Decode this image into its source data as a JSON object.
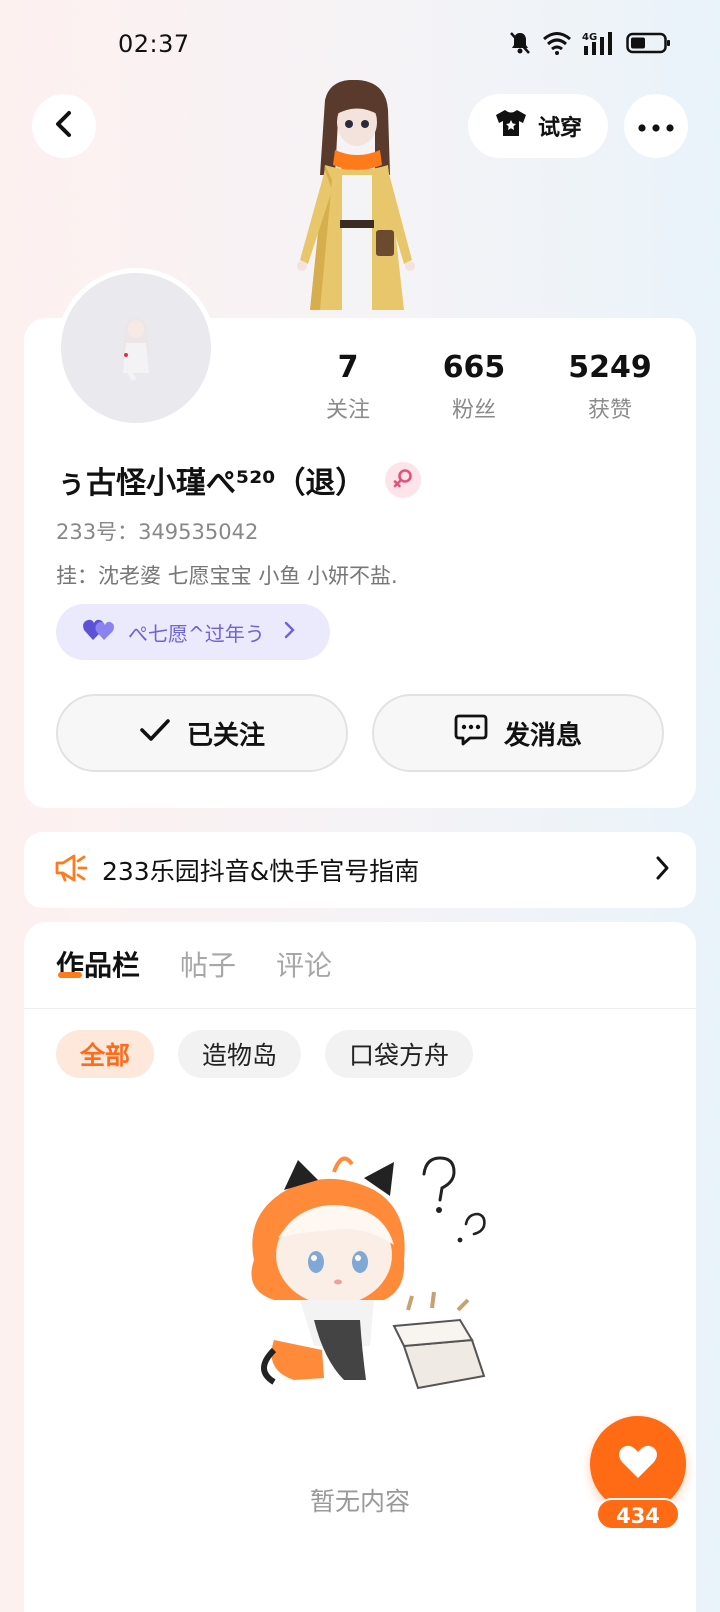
{
  "status_bar": {
    "time": "02:37",
    "network": "4G"
  },
  "header": {
    "try_on_label": "试穿",
    "icons": [
      "back-icon",
      "tshirt-icon",
      "more-icon"
    ]
  },
  "profile": {
    "stats": [
      {
        "value": "7",
        "label": "关注"
      },
      {
        "value": "665",
        "label": "粉丝"
      },
      {
        "value": "5249",
        "label": "获赞"
      }
    ],
    "username": "ぅ古怪小瑾ぺ⁵²⁰（退）",
    "gender": "female",
    "user_id": "233号：349535042",
    "bio": "挂：沈老婆 七愿宝宝 小鱼 小妍不盐.",
    "cp_label": "ぺ七愿^过年う",
    "follow_label": "已关注",
    "message_label": "发消息"
  },
  "notice": {
    "text": "233乐园抖音&快手官号指南"
  },
  "content": {
    "tabs": [
      {
        "label": "作品栏",
        "active": true
      },
      {
        "label": "帖子",
        "active": false
      },
      {
        "label": "评论",
        "active": false
      }
    ],
    "chips": [
      {
        "label": "全部",
        "active": true
      },
      {
        "label": "造物岛",
        "active": false
      },
      {
        "label": "口袋方舟",
        "active": false
      }
    ],
    "empty_text": "暂无内容"
  },
  "like": {
    "count": "434"
  },
  "colors": {
    "accent": "#ff6a14",
    "cp_purple": "#6e63d9",
    "female_pink": "#e8507a"
  }
}
